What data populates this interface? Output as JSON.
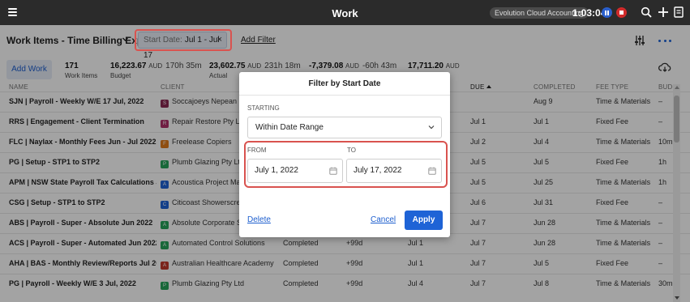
{
  "topbar": {
    "title": "Work",
    "org": "Evolution Cloud Accounting",
    "timer": "1:03:04"
  },
  "header": {
    "view_title": "Work Items - Time Billing Export",
    "chip_key": "Start Date:",
    "chip_value": "Jul 1 - Jul 17",
    "chip_close": "×",
    "add_filter": "Add Filter"
  },
  "stats": {
    "add_work": "Add Work",
    "work_items_value": "171",
    "work_items_label": "Work Items",
    "budget_value": "16,223.67",
    "budget_unit": "AUD",
    "budget_hours": "170h 35m",
    "budget_label": "Budget",
    "actual_value": "23,602.75",
    "actual_unit": "AUD",
    "actual_hours": "231h 18m",
    "actual_label": "Actual",
    "variance_value": "-7,379.08",
    "variance_unit": "AUD",
    "variance_hours": "-60h 43m",
    "billed_value": "17,711.20",
    "billed_unit": "AUD"
  },
  "table": {
    "columns": {
      "name": "NAME",
      "client": "CLIENT",
      "due": "DUE",
      "completed": "COMPLETED",
      "fee_type": "FEE TYPE",
      "budget": "BUDG"
    },
    "rows": [
      {
        "name": "SJN | Payroll - Weekly W/E 17 Jul, 2022",
        "badge": "S",
        "badge_color": "#8a2a52",
        "client": "Soccajoeys Nepean",
        "status": "",
        "age": "",
        "start": "",
        "due": "",
        "completed": "Aug 9",
        "fee": "Time & Materials",
        "budget": "–"
      },
      {
        "name": "RRS | Engagement - Client Termination",
        "badge": "R",
        "badge_color": "#b0306a",
        "client": "Repair Restore Pty Ltd",
        "status": "",
        "age": "",
        "start": "",
        "due": "Jul 1",
        "completed": "Jul 1",
        "fee": "Fixed Fee",
        "budget": "–"
      },
      {
        "name": "FLC | Naylax - Monthly Fees Jun - Jul 2022",
        "badge": "F",
        "badge_color": "#e07a1c",
        "client": "Freelease Copiers",
        "status": "",
        "age": "",
        "start": "",
        "due": "Jul 2",
        "completed": "Jul 4",
        "fee": "Time & Materials",
        "budget": "10m"
      },
      {
        "name": "PG | Setup - STP1 to STP2",
        "badge": "P",
        "badge_color": "#27a35a",
        "client": "Plumb Glazing Pty Ltd",
        "status": "",
        "age": "",
        "start": "",
        "due": "Jul 5",
        "completed": "Jul 5",
        "fee": "Fixed Fee",
        "budget": "1h"
      },
      {
        "name": "APM | NSW State Payroll Tax Calculations Jun",
        "badge": "A",
        "badge_color": "#1e63d6",
        "client": "Acoustica Project Management",
        "status": "",
        "age": "",
        "start": "",
        "due": "Jul 5",
        "completed": "Jul 25",
        "fee": "Time & Materials",
        "budget": "1h"
      },
      {
        "name": "CSG | Setup - STP1 to STP2",
        "badge": "C",
        "badge_color": "#1e63d6",
        "client": "Citicoast Showerscreens",
        "status": "",
        "age": "",
        "start": "",
        "due": "Jul 6",
        "completed": "Jul 31",
        "fee": "Fixed Fee",
        "budget": "–"
      },
      {
        "name": "ABS | Payroll - Super - Absolute Jun 2022",
        "badge": "A",
        "badge_color": "#27a35a",
        "client": "Absolute Corporate Solutions",
        "status": "",
        "age": "",
        "start": "",
        "due": "Jul 7",
        "completed": "Jun 28",
        "fee": "Time & Materials",
        "budget": "–"
      },
      {
        "name": "ACS | Payroll - Super - Automated  Jun 2022",
        "badge": "A",
        "badge_color": "#27a35a",
        "client": "Automated Control Solutions",
        "status": "Completed",
        "age": "+99d",
        "start": "Jul 1",
        "due": "Jul 7",
        "completed": "Jun 28",
        "fee": "Time & Materials",
        "budget": "–"
      },
      {
        "name": "AHA | BAS - Monthly Review/Reports Jul 2022",
        "badge": "A",
        "badge_color": "#c0392b",
        "client": "Australian Healthcare Academy",
        "status": "Completed",
        "age": "+99d",
        "start": "Jul 1",
        "due": "Jul 7",
        "completed": "Jul 5",
        "fee": "Fixed Fee",
        "budget": "–"
      },
      {
        "name": "PG | Payroll - Weekly W/E 3 Jul, 2022",
        "badge": "P",
        "badge_color": "#27a35a",
        "client": "Plumb Glazing Pty Ltd",
        "status": "Completed",
        "age": "+99d",
        "start": "Jul 4",
        "due": "Jul 7",
        "completed": "Jul 8",
        "fee": "Time & Materials",
        "budget": "30m"
      }
    ]
  },
  "modal": {
    "title": "Filter by Start Date",
    "starting_label": "STARTING",
    "range_option": "Within Date Range",
    "from_label": "FROM",
    "from_value": "July 1, 2022",
    "to_label": "TO",
    "to_value": "July 17, 2022",
    "delete": "Delete",
    "cancel": "Cancel",
    "apply": "Apply"
  },
  "icons": [
    "menu-icon",
    "pause-icon",
    "stop-icon",
    "search-icon",
    "plus-icon",
    "document-icon",
    "chevron-down-icon",
    "close-icon",
    "sliders-icon",
    "more-icon",
    "cloud-download-icon",
    "calendar-icon",
    "sort-up-icon"
  ],
  "colors": {
    "topbar": "#2b2b2b",
    "accent": "#1e63d6",
    "highlight": "#d9534f"
  }
}
